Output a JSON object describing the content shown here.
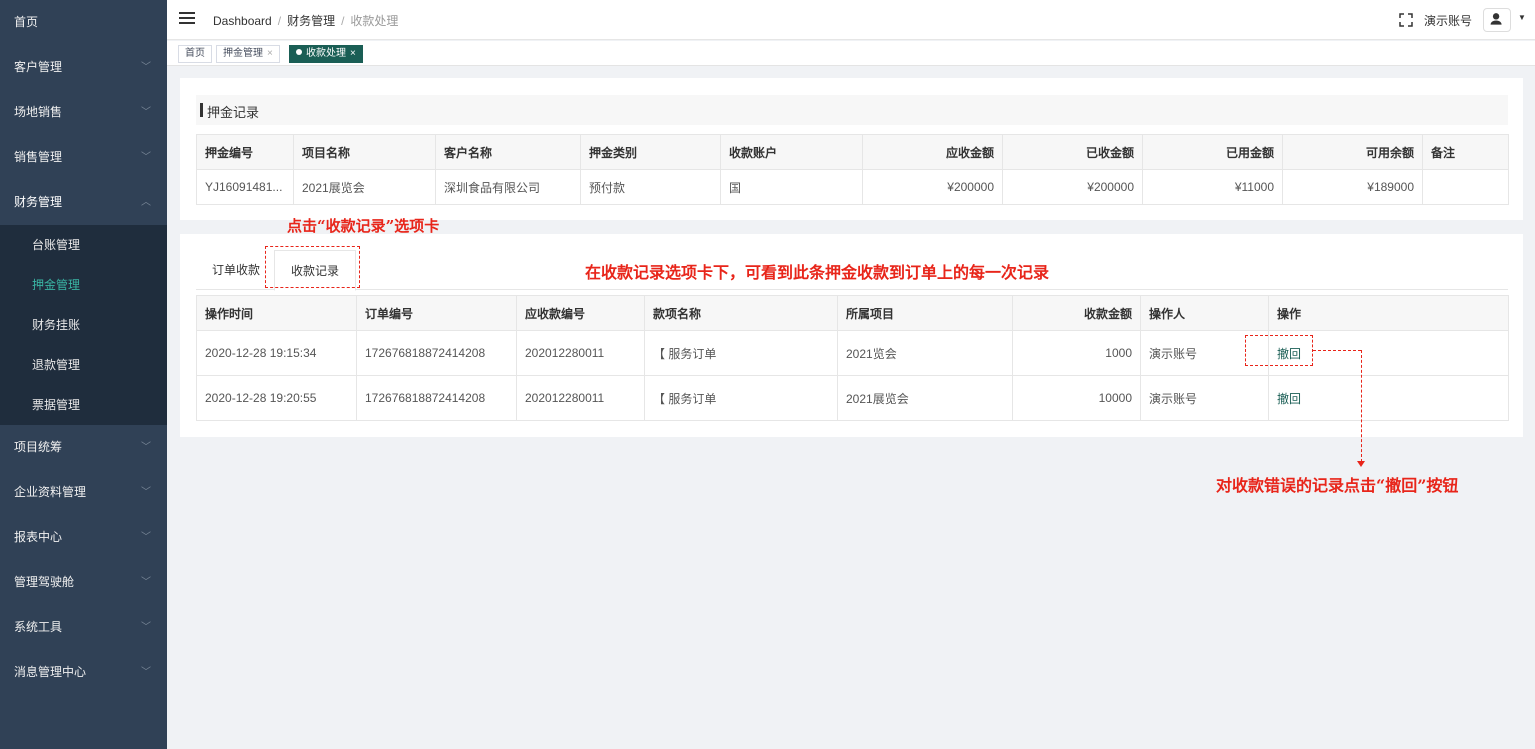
{
  "sidebar": {
    "items": [
      {
        "label": "首页",
        "has_arrow": false
      },
      {
        "label": "客户管理",
        "has_arrow": true
      },
      {
        "label": "场地销售",
        "has_arrow": true
      },
      {
        "label": "销售管理",
        "has_arrow": true
      },
      {
        "label": "财务管理",
        "has_arrow": true,
        "open": true
      },
      {
        "label": "项目统筹",
        "has_arrow": true
      },
      {
        "label": "企业资料管理",
        "has_arrow": true
      },
      {
        "label": "报表中心",
        "has_arrow": true
      },
      {
        "label": "管理驾驶舱",
        "has_arrow": true
      },
      {
        "label": "系统工具",
        "has_arrow": true
      },
      {
        "label": "消息管理中心",
        "has_arrow": true
      }
    ],
    "finance_sub": [
      "台账管理",
      "押金管理",
      "财务挂账",
      "退款管理",
      "票据管理"
    ],
    "active_sub": "押金管理"
  },
  "header": {
    "breadcrumb": [
      "Dashboard",
      "财务管理",
      "收款处理"
    ],
    "user_name": "演示账号"
  },
  "tags": [
    {
      "label": "首页",
      "active": false,
      "closable": false
    },
    {
      "label": "押金管理",
      "active": false,
      "closable": true
    },
    {
      "label": "收款处理",
      "active": true,
      "closable": true
    }
  ],
  "deposit_panel": {
    "title": "押金记录",
    "columns": [
      "押金编号",
      "项目名称",
      "客户名称",
      "押金类别",
      "收款账户",
      "应收金额",
      "已收金额",
      "已用金额",
      "可用余额",
      "备注"
    ],
    "rows": [
      [
        "YJ16091481...",
        "2021展览会",
        "深圳食品有限公司",
        "预付款",
        "国",
        "¥200000",
        "¥200000",
        "¥11000",
        "¥189000",
        ""
      ]
    ]
  },
  "tabs": [
    {
      "label": "订单收款",
      "active": false
    },
    {
      "label": "收款记录",
      "active": true
    }
  ],
  "records": {
    "columns": [
      "操作时间",
      "订单编号",
      "应收款编号",
      "款项名称",
      "所属项目",
      "收款金额",
      "操作人",
      "操作"
    ],
    "rows": [
      [
        "2020-12-28 19:15:34",
        "172676818872414208",
        "202012280011",
        "【 服务订单",
        "2021览会",
        "1000",
        "演示账号",
        "撤回"
      ],
      [
        "2020-12-28 19:20:55",
        "172676818872414208",
        "202012280011",
        "【 服务订单",
        "2021展览会",
        "10000",
        "演示账号",
        "撤回"
      ]
    ]
  },
  "annotations": {
    "click_tab": "点击“收款记录”选项卡",
    "tab_desc": "在收款记录选项卡下，可看到此条押金收款到订单上的每一次记录",
    "revoke_desc": "对收款错误的记录点击“撤回”按钮"
  },
  "colors": {
    "sidebar_bg": "#304156",
    "accent": "#1a5e55",
    "annotation": "#e8251a"
  }
}
